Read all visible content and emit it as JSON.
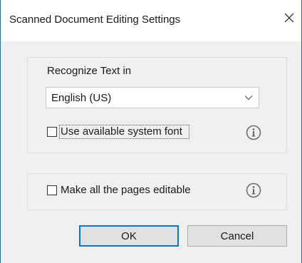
{
  "dialog": {
    "title": "Scanned Document Editing Settings",
    "close_icon": "close-icon"
  },
  "recognize": {
    "label": "Recognize Text in",
    "language_selected": "English (US)",
    "dropdown_icon": "chevron-down-icon"
  },
  "options": {
    "use_system_font_label": "Use available system font",
    "use_system_font_checked": false,
    "make_editable_label": "Make all the pages editable",
    "make_editable_checked": false,
    "info_icon": "info-icon"
  },
  "buttons": {
    "ok": "OK",
    "cancel": "Cancel"
  },
  "colors": {
    "accent": "#0078d7",
    "window_border": "#2b6cb0",
    "panel_bg": "#f0f0f0"
  }
}
